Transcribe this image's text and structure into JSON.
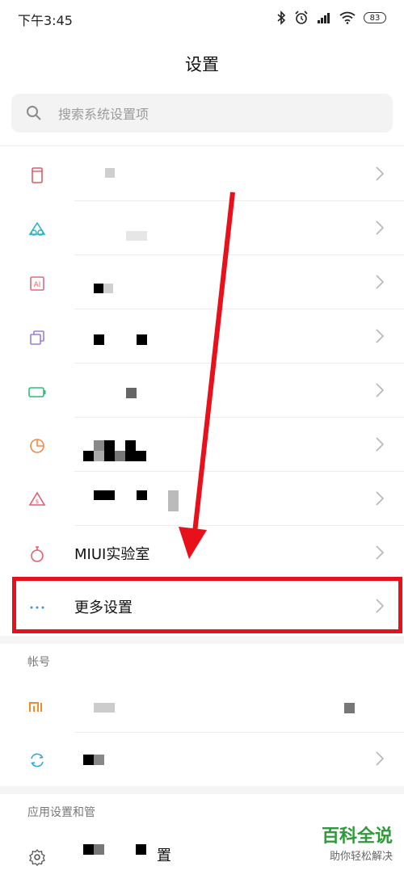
{
  "status_bar": {
    "time": "下午3:45",
    "battery": "83"
  },
  "header": {
    "title": "设置"
  },
  "search": {
    "placeholder": "搜索系统设置项"
  },
  "items": [
    {
      "label": "",
      "icon": "phone-icon",
      "color": "#e05a63"
    },
    {
      "label": "",
      "icon": "theme-icon",
      "color": "#25b6c9"
    },
    {
      "label": "",
      "icon": "ai-icon",
      "color": "#e36878"
    },
    {
      "label": "",
      "icon": "copy-icon",
      "color": "#9a7ee0"
    },
    {
      "label": "",
      "icon": "battery-icon",
      "color": "#2fbf78"
    },
    {
      "label": "",
      "icon": "pie-icon",
      "color": "#f08a4a"
    },
    {
      "label": "",
      "icon": "security-icon",
      "color": "#e26070"
    },
    {
      "label": "MIUI实验室",
      "icon": "flask-icon",
      "color": "#e26070"
    },
    {
      "label": "更多设置",
      "icon": "more-icon",
      "color": "#3a8fe6"
    }
  ],
  "section_account": {
    "header": "帐号"
  },
  "account_items": [
    {
      "label": "",
      "icon": "mi-icon",
      "color": "#f08a2a"
    },
    {
      "label": "",
      "icon": "sync-icon",
      "color": "#25a7d8"
    }
  ],
  "section_apps": {
    "header": "应用设置和管"
  },
  "app_items": [
    {
      "label": "置",
      "icon": "gear-icon",
      "color": "#555555"
    }
  ],
  "watermark": {
    "title": "百科全说",
    "subtitle": "助你轻松解决"
  }
}
